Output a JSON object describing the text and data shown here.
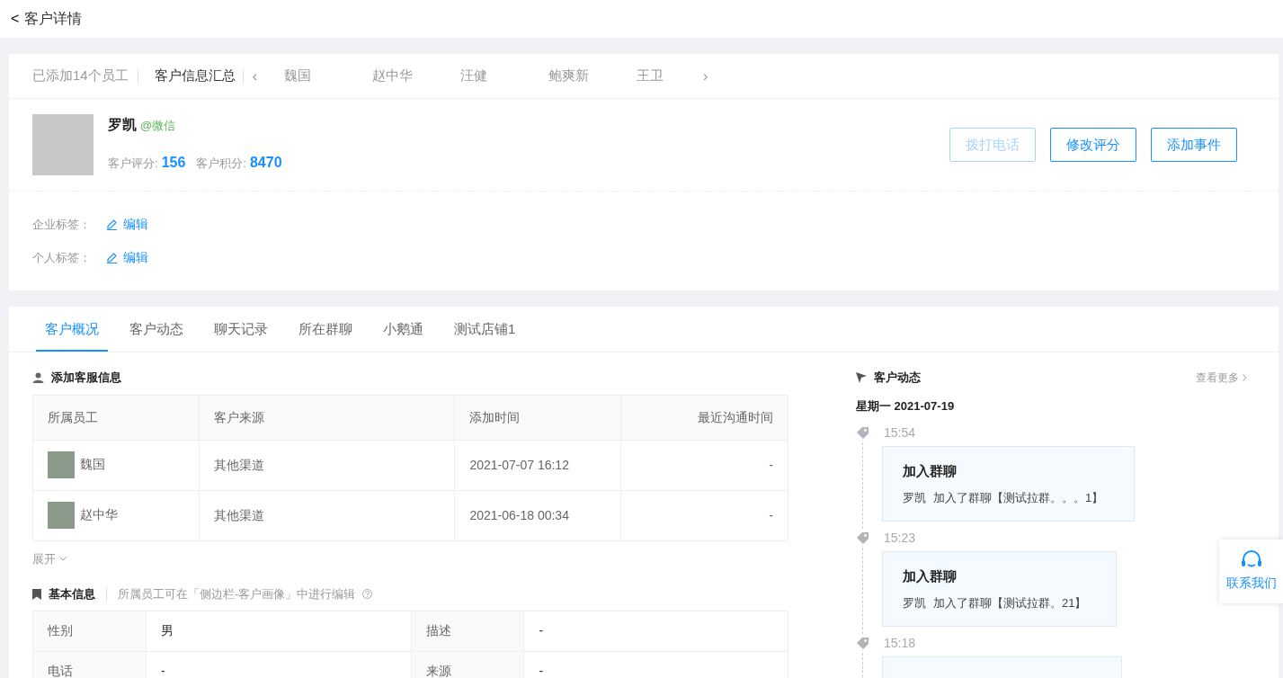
{
  "header": {
    "back": "<",
    "title": "客户详情"
  },
  "staff_bar": {
    "count": "已添加14个员工",
    "summary": {
      "label": "客户信息汇总",
      "selected": true
    },
    "prev": "‹",
    "next": "›",
    "staff": [
      {
        "label": "魏国",
        "selected": false
      },
      {
        "label": "赵中华",
        "selected": false
      },
      {
        "label": "汪健",
        "selected": false
      },
      {
        "label": "鲍爽新",
        "selected": false
      },
      {
        "label": "王卫",
        "selected": false
      }
    ]
  },
  "profile": {
    "name": "罗凯",
    "source": "@微信",
    "score_label": "客户评分:",
    "score": "156",
    "points_label": "客户积分:",
    "points": "8470",
    "buttons": [
      {
        "label": "拨打电话",
        "disabled": true
      },
      {
        "label": "修改评分",
        "disabled": false
      },
      {
        "label": "添加事件",
        "disabled": false
      }
    ],
    "tags": [
      {
        "label": "企业标签：",
        "action": "编辑"
      },
      {
        "label": "个人标签：",
        "action": "编辑"
      }
    ]
  },
  "tabs": [
    {
      "label": "客户概况",
      "selected": true
    },
    {
      "label": "客户动态",
      "selected": false
    },
    {
      "label": "聊天记录",
      "selected": false
    },
    {
      "label": "所在群聊",
      "selected": false
    },
    {
      "label": "小鹅通",
      "selected": false
    },
    {
      "label": "测试店铺1",
      "selected": false
    }
  ],
  "service_info": {
    "title": "添加客服信息",
    "columns": [
      "所属员工",
      "客户来源",
      "添加时间",
      "最近沟通时间"
    ],
    "rows": [
      [
        "魏国",
        "其他渠道",
        "2021-07-07 16:12",
        "-"
      ],
      [
        "赵中华",
        "其他渠道",
        "2021-06-18 00:34",
        "-"
      ]
    ],
    "expand": "展开"
  },
  "basic_info": {
    "title": "基本信息",
    "hint": "所属员工可在「侧边栏-客户画像」中进行编辑",
    "rows": [
      [
        "性别",
        "男",
        "描述",
        "-"
      ],
      [
        "电话",
        "-",
        "来源",
        "-"
      ]
    ]
  },
  "activity": {
    "title": "客户动态",
    "more": "查看更多",
    "date": "星期一 2021-07-19",
    "events": [
      {
        "time": "15:54",
        "title": "加入群聊",
        "actor": "罗凯",
        "text": "加入了群聊【测试拉群。。。1】"
      },
      {
        "time": "15:23",
        "title": "加入群聊",
        "actor": "罗凯",
        "text": "加入了群聊【测试拉群。21】"
      },
      {
        "time": "15:18"
      }
    ]
  },
  "contact": {
    "label": "联系我们"
  }
}
